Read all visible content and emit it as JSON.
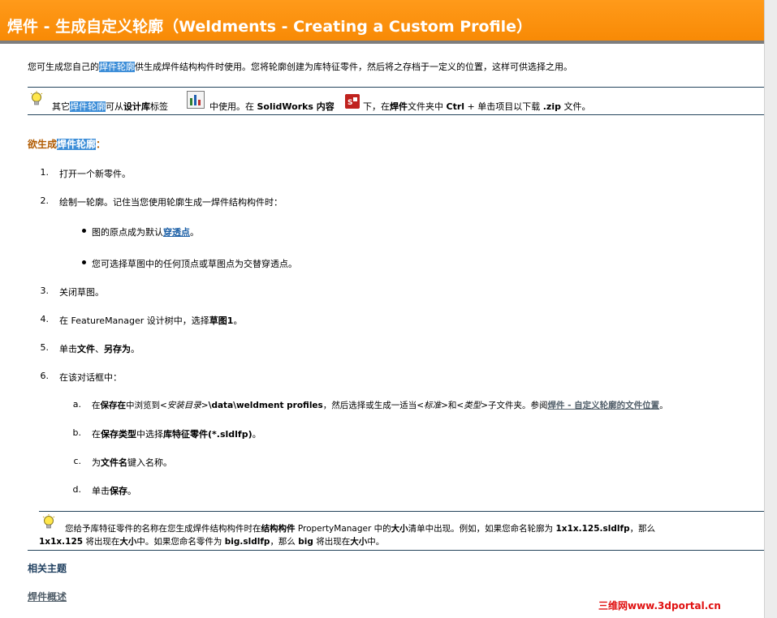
{
  "header": {
    "title": "焊件 - 生成自定义轮廓（Weldments - Creating a Custom Profile）"
  },
  "intro": {
    "before": "您可生成您自己的",
    "hl": "焊件轮廓",
    "after": "供生成焊件结构构件时使用。您将轮廓创建为库特征零件，然后将之存档于一定义的位置，这样可供选择之用。"
  },
  "tip1": {
    "t1": "其它",
    "hl": "焊件轮廓",
    "t2": "可从",
    "b1": "设计库",
    "t3": "标签",
    "t4": "中使用。在",
    "b2": "SolidWorks 内容",
    "t5": "下，在",
    "b3": "焊件",
    "t6": "文件夹中",
    "b4": "Ctrl",
    "t7": "+ 单击项目以下载",
    "b5": ".zip",
    "t8": "文件。"
  },
  "procedure": {
    "lead": "欲生成",
    "hl": "焊件轮廓",
    "colon": "："
  },
  "steps": [
    {
      "n": "1.",
      "text": "打开一个新零件。"
    },
    {
      "n": "2.",
      "text": "绘制一轮廓。记住当您使用轮廓生成一焊件结构构件时："
    },
    {
      "n": "3.",
      "text": "关闭草图。"
    },
    {
      "n": "4.",
      "t1": "在 FeatureManager 设计树中，选择",
      "b1": "草图1",
      "t2": "。"
    },
    {
      "n": "5.",
      "t1": "单击",
      "b1": "文件",
      "t2": "、",
      "b2": "另存为",
      "t3": "。"
    },
    {
      "n": "6.",
      "text": "在该对话框中："
    }
  ],
  "bullets": [
    {
      "t1": "图的原点成为默认",
      "link": "穿透点",
      "t2": "。"
    },
    {
      "text": "您可选择草图中的任何顶点或草图点为交替穿透点。"
    }
  ],
  "substeps": [
    {
      "n": "a.",
      "t1": "在",
      "b1": "保存在",
      "t2": "中浏览到",
      "i1": "<安装目录>",
      "b2": "\\data\\weldment profiles",
      "t3": "，然后选择或生成一适当",
      "i2": "<标准>",
      "t4": "和",
      "i3": "<类型>",
      "t5": "子文件夹。参阅",
      "link": "焊件 - 自定义轮廓的文件位置",
      "t6": "。"
    },
    {
      "n": "b.",
      "t1": "在",
      "b1": "保存类型",
      "t2": "中选择",
      "b2": "库特征零件(*.sldlfp)",
      "t3": "。"
    },
    {
      "n": "c.",
      "t1": "为",
      "b1": "文件名",
      "t2": "键入名称。"
    },
    {
      "n": "d.",
      "t1": "单击",
      "b1": "保存",
      "t2": "。"
    }
  ],
  "tip2": {
    "t1": "您给予库特征零件的名称在您生成焊件结构构件时在",
    "b1": "结构构件",
    "t2": "PropertyManager 中的",
    "b2": "大小",
    "t3": "清单中出现。例如，如果您命名轮廓为",
    "b3": "1x1x.125.sldlfp",
    "t4": "，那么",
    "b4": "1x1x.125",
    "t5": "将出现在",
    "b5": "大小",
    "t6": "中。如果您命名零件为",
    "b6": "big.sldlfp",
    "t7": "，那么",
    "b7": "big",
    "t8": "将出现在",
    "b8": "大小",
    "t9": "中。"
  },
  "related": {
    "heading": "相关主题",
    "link": "焊件概述"
  },
  "watermark": "三维网www.3dportal.cn",
  "icons": {
    "tip": "lightbulb-icon",
    "library": "design-library-icon",
    "sw": "solidworks-content-icon"
  }
}
